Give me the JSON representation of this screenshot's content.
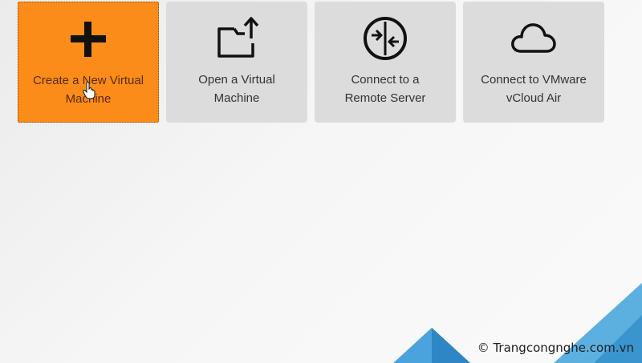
{
  "tiles": [
    {
      "line1": "Create a New Virtual",
      "line2": "Machine",
      "icon": "plus-icon",
      "state": "hover"
    },
    {
      "line1": "Open a Virtual",
      "line2": "Machine",
      "icon": "folder-open-icon"
    },
    {
      "line1": "Connect to a",
      "line2": "Remote Server",
      "icon": "remote-connect-icon"
    },
    {
      "line1": "Connect to VMware",
      "line2": "vCloud Air",
      "icon": "cloud-icon"
    }
  ],
  "colors": {
    "accent": "#fb8c1a",
    "tile_bg": "#dcdcdc",
    "triangle_blue": "#4aa3dc"
  },
  "watermark": "© Trangcongnghe.com.vn"
}
